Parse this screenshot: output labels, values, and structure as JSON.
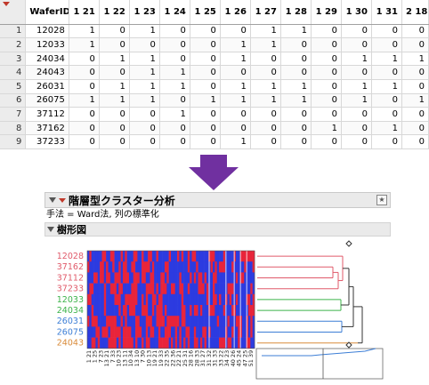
{
  "table": {
    "columns": [
      "WaferID",
      "1 21",
      "1 22",
      "1 23",
      "1 24",
      "1 25",
      "1 26",
      "1 27",
      "1 28",
      "1 29",
      "1 30",
      "1 31",
      "2 18"
    ],
    "rows": [
      {
        "n": "1",
        "cells": [
          "12028",
          "1",
          "0",
          "1",
          "0",
          "0",
          "0",
          "1",
          "1",
          "0",
          "0",
          "0",
          "0"
        ]
      },
      {
        "n": "2",
        "cells": [
          "12033",
          "1",
          "0",
          "0",
          "0",
          "0",
          "1",
          "1",
          "0",
          "0",
          "0",
          "0",
          "0"
        ]
      },
      {
        "n": "3",
        "cells": [
          "24034",
          "0",
          "1",
          "1",
          "0",
          "0",
          "1",
          "0",
          "0",
          "0",
          "1",
          "1",
          "1"
        ]
      },
      {
        "n": "4",
        "cells": [
          "24043",
          "0",
          "0",
          "1",
          "1",
          "0",
          "0",
          "0",
          "0",
          "0",
          "0",
          "0",
          "0"
        ]
      },
      {
        "n": "5",
        "cells": [
          "26031",
          "0",
          "1",
          "1",
          "1",
          "0",
          "1",
          "1",
          "1",
          "0",
          "1",
          "1",
          "0"
        ]
      },
      {
        "n": "6",
        "cells": [
          "26075",
          "1",
          "1",
          "1",
          "0",
          "1",
          "1",
          "1",
          "1",
          "0",
          "1",
          "0",
          "1"
        ]
      },
      {
        "n": "7",
        "cells": [
          "37112",
          "0",
          "0",
          "0",
          "1",
          "0",
          "0",
          "0",
          "0",
          "0",
          "0",
          "0",
          "0"
        ]
      },
      {
        "n": "8",
        "cells": [
          "37162",
          "0",
          "0",
          "0",
          "0",
          "0",
          "0",
          "0",
          "0",
          "1",
          "0",
          "1",
          "0"
        ]
      },
      {
        "n": "9",
        "cells": [
          "37233",
          "0",
          "0",
          "0",
          "0",
          "0",
          "1",
          "0",
          "0",
          "0",
          "0",
          "0",
          "0"
        ]
      }
    ]
  },
  "colors": {
    "arrow": "#7030a0",
    "heat_high": "#e8243a",
    "heat_low": "#2c3be0",
    "cluster_red": "#e05a6a",
    "cluster_green": "#3cb34a",
    "cluster_blue": "#3c7ed6",
    "cluster_orange": "#d98b3a",
    "label_red": "#e05a6a",
    "label_green": "#3cb34a",
    "label_blue": "#3c7ed6",
    "label_orange": "#d98b3a"
  },
  "report": {
    "title": "階層型クラスター分析",
    "method": "手法 = Ward法, 列の標準化",
    "dendrogram_title": "樹形図",
    "icons": [
      "red-triangle-menu-icon",
      "disclosure-icon",
      "report-options-icon"
    ]
  },
  "dendrogram": {
    "rows": [
      {
        "label": "12028",
        "cluster": "red"
      },
      {
        "label": "37162",
        "cluster": "red"
      },
      {
        "label": "37112",
        "cluster": "red"
      },
      {
        "label": "37233",
        "cluster": "red"
      },
      {
        "label": "12033",
        "cluster": "green"
      },
      {
        "label": "24034",
        "cluster": "green"
      },
      {
        "label": "26031",
        "cluster": "blue"
      },
      {
        "label": "26075",
        "cluster": "blue"
      },
      {
        "label": "24043",
        "cluster": "orange"
      }
    ],
    "column_labels": [
      "1 21",
      "1 25",
      "7 23",
      "13 21",
      "7 33",
      "10 23",
      "13 11",
      "10 34",
      "13 10",
      "7 30",
      "10 13",
      "19 21",
      "19 33",
      "22 35",
      "22 36",
      "22 21",
      "25 31",
      "28 16",
      "28 33",
      "31 27",
      "31 32",
      "31 33",
      "33 22",
      "34 23",
      "40 26",
      "45 24",
      "47 25",
      "51 39"
    ]
  }
}
